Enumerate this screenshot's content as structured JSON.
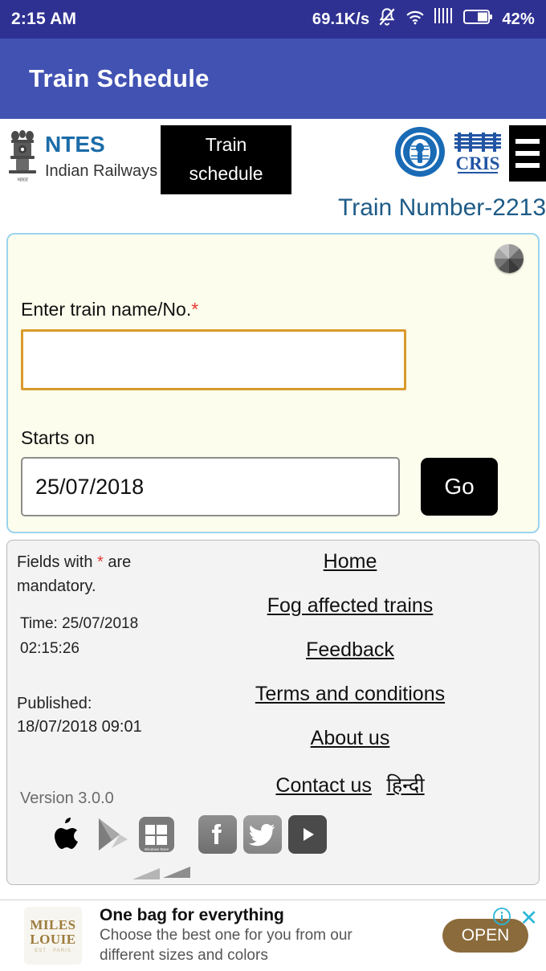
{
  "statusbar": {
    "time": "2:15 AM",
    "network_speed": "69.1K/s",
    "battery_percent": "42%",
    "icons": [
      "bell-muted-icon",
      "wifi-icon",
      "signal-bars-icon",
      "battery-icon"
    ]
  },
  "appbar": {
    "title": "Train Schedule"
  },
  "site_header": {
    "emblem_icon": "india-emblem-icon",
    "brand_name": "NTES",
    "brand_sub": "Indian Railways",
    "train_schedule_button_line1": "Train",
    "train_schedule_button_line2": "schedule",
    "indian_railways_logo": "indian-railways-logo",
    "cris_logo_line1": "भारत",
    "cris_logo_line2": "CRIS",
    "menu_icon": "hamburger-menu-icon",
    "train_number": "Train Number-2213"
  },
  "form": {
    "spinner_icon": "loading-spinner-icon",
    "train_label": "Enter train name/No.",
    "required_mark": "*",
    "train_value": "",
    "train_placeholder": "",
    "starts_on_label": "Starts on",
    "date_value": "25/07/2018",
    "go_label": "Go"
  },
  "footer": {
    "mandatory_note": "Fields with * are mandatory.",
    "mandatory_note_pre": "Fields with ",
    "mandatory_note_post": " are mandatory.",
    "time_label": "Time: 25/07/2018",
    "time_value": "02:15:26",
    "published_label": "Published:",
    "published_value": "18/07/2018 09:01",
    "links": [
      {
        "label": "Home",
        "name": "link-home"
      },
      {
        "label": "Fog affected trains",
        "name": "link-fog-affected-trains"
      },
      {
        "label": "Feedback",
        "name": "link-feedback"
      },
      {
        "label": "Terms and conditions",
        "name": "link-terms-and-conditions"
      },
      {
        "label": "About us",
        "name": "link-about-us"
      },
      {
        "label": "Contact us",
        "name": "link-contact-us"
      },
      {
        "label": "हिन्दी",
        "name": "link-hindi"
      }
    ],
    "version": "Version 3.0.0",
    "store_icons": [
      "apple-app-store-icon",
      "google-play-icon",
      "windows-store-icon"
    ],
    "windows_store_caption": "Windows Store",
    "social_icons": [
      "facebook-icon",
      "twitter-icon",
      "youtube-icon"
    ]
  },
  "ad": {
    "logo_line1": "MILES",
    "logo_line2": "LOUIE",
    "logo_line3": "EST · PARIS",
    "title": "One bag for everything",
    "body_line1": "Choose the best one for you from our",
    "body_line2": "different sizes and colors",
    "open_label": "OPEN",
    "info_icon": "info-icon",
    "close_icon": "✕"
  },
  "colors": {
    "statusbar_bg": "#2f3192",
    "appbar_bg": "#4152b3",
    "brand_blue": "#1b6ca8",
    "panel_border_blue": "#9bd3ef",
    "panel_bg_cream": "#fcfdec",
    "input_border_orange": "#d99a2b",
    "required_red": "#e53935",
    "ad_gold": "#8b6b3b",
    "ad_cyan": "#29b6d8"
  }
}
